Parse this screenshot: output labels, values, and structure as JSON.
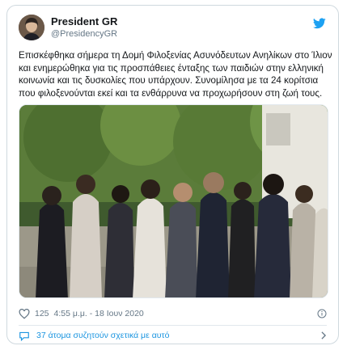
{
  "tweet": {
    "display_name": "President GR",
    "handle": "@PresidencyGR",
    "text": "Επισκέφθηκα σήμερα τη Δομή Φιλοξενίας Ασυνόδευτων Ανηλίκων στο Ίλιον και ενημερώθηκα για τις προσπάθειες ένταξης των παιδιών στην ελληνική κοινωνία και τις δυσκολίες που υπάρχουν. Συνομίλησα με τα 24 κορίτσια που φιλοξενούνται εκεί και τα ενθάρρυνα να προχωρήσουν στη ζωή τους.",
    "like_count": "125",
    "timestamp": "4:55 μ.μ. - 18 Ιουν 2020",
    "conversation_text": "37 άτομα συζητούν σχετικά με αυτό"
  },
  "icons": {
    "brand": "twitter-bird-icon",
    "like": "heart-icon",
    "info": "info-icon",
    "conversation": "speech-bubble-icon",
    "chevron": "chevron-right-icon"
  },
  "colors": {
    "brand": "#1da1f2",
    "link": "#1b95e0",
    "text": "#14171a",
    "muted": "#657786",
    "border": "#cfd9de"
  }
}
